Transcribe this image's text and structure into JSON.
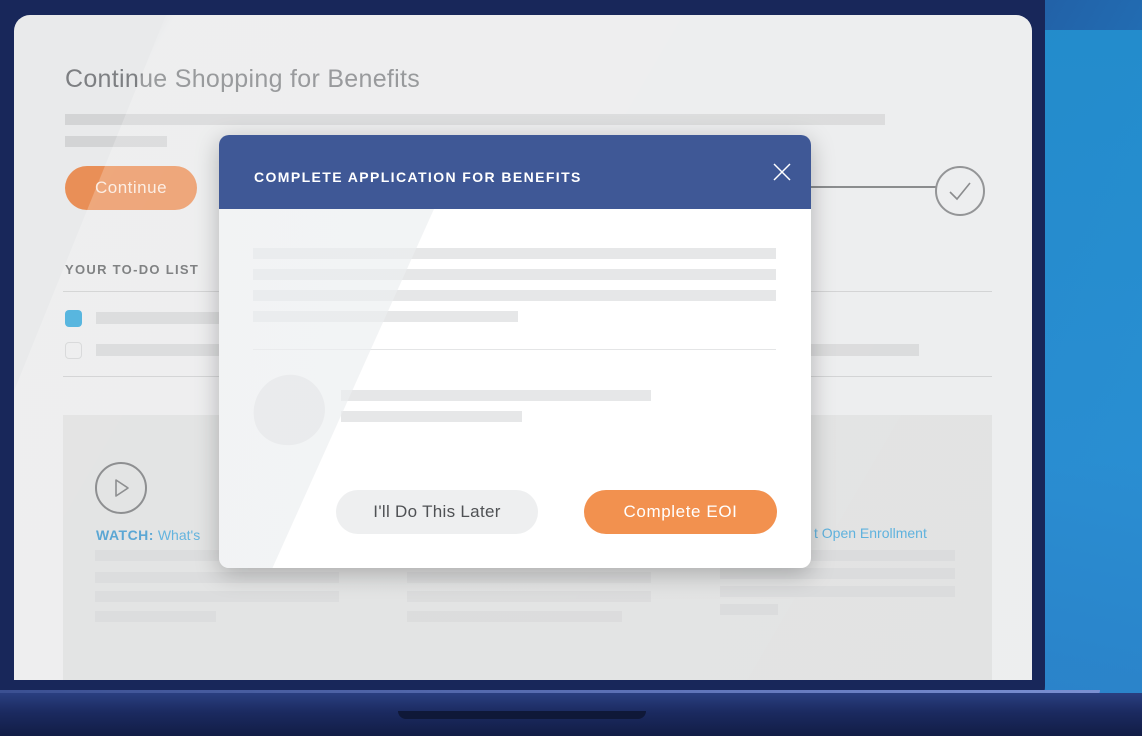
{
  "page": {
    "title": "Continue Shopping for Benefits",
    "continue_label": "Continue",
    "todo_heading": "YOUR TO-DO LIST",
    "watch_prefix": "WATCH:",
    "watch_text": "What's",
    "open_enrollment_link": "t Open Enrollment"
  },
  "modal": {
    "title": "COMPLETE APPLICATION FOR BENEFITS",
    "later_label": "I'll Do This Later",
    "complete_label": "Complete EOI"
  },
  "colors": {
    "accent_orange": "#f2914f",
    "modal_header": "#3f5896",
    "checked_blue": "#2aa2d6",
    "link_blue": "#3aa0d6"
  },
  "icons": [
    "check-icon",
    "play-icon",
    "close-icon"
  ]
}
